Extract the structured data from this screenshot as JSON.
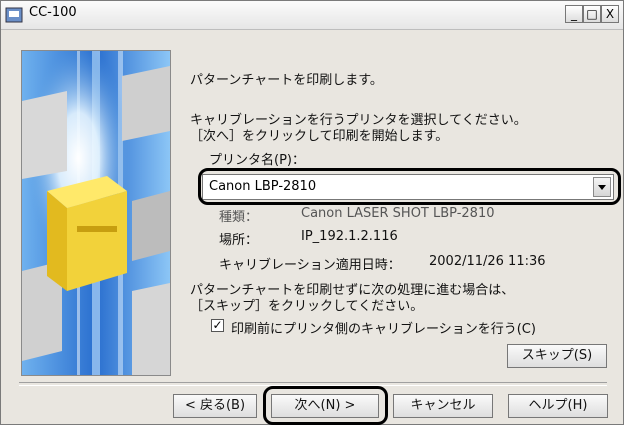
{
  "window": {
    "title": "CC-100",
    "controls": [
      "_",
      "□",
      "X"
    ]
  },
  "main": {
    "heading": "パターンチャートを印刷します。",
    "instruction_line1": "キャリブレーションを行うプリンタを選択してください。",
    "instruction_line2": "［次へ］をクリックして印刷を開始します。",
    "printer_label": "プリンタ名(P)：",
    "printer_selected": "Canon LBP-2810",
    "type_label": "種類：",
    "type_value": "Canon LASER SHOT LBP-2810",
    "location_label": "場所：",
    "location_value": "IP_192.1.2.116",
    "calib_datetime_label": "キャリブレーション適用日時：",
    "calib_datetime_value": "2002/11/26  11:36",
    "skip_note_line1": "パターンチャートを印刷せずに次の処理に進む場合は、",
    "skip_note_line2": "［スキップ］をクリックしてください。",
    "checkbox_label": "印刷前にプリンタ側のキャリブレーションを行う(C)",
    "checkbox_checked": "✓",
    "skip_button": "スキップ(S)"
  },
  "footer": {
    "back_button": "< 戻る(B)",
    "next_button": "次へ(N) >",
    "cancel_button": "キャンセル",
    "help_button": "ヘルプ(H)"
  },
  "colors": {
    "window_bg": "#e9e6e0",
    "illustration_blue": "#5a9fe0",
    "printer_yellow": "#f2d23a"
  }
}
